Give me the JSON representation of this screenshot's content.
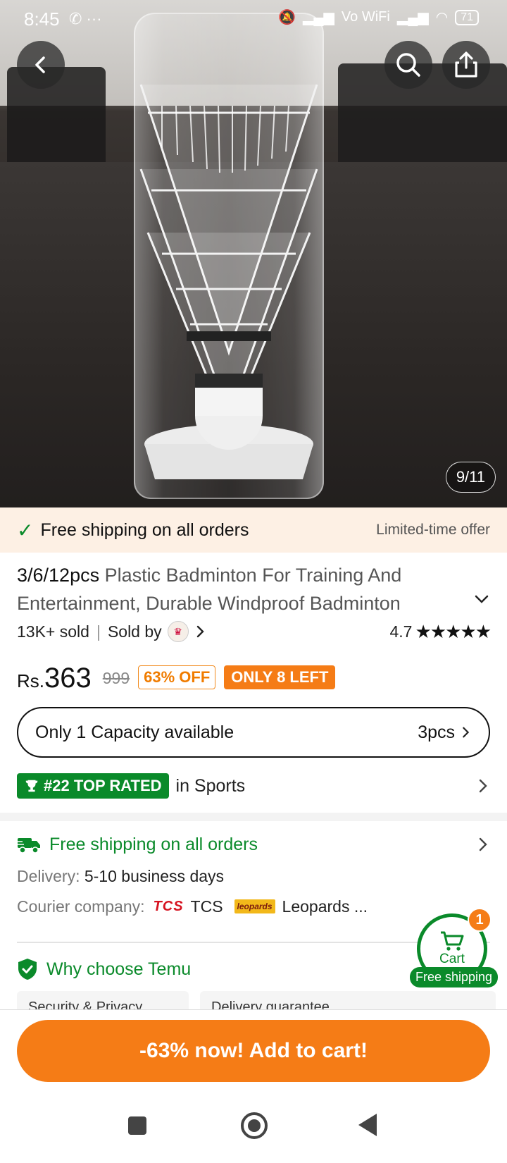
{
  "status_bar": {
    "time": "8:45",
    "left_icons": "✆ ···",
    "signal": "Vo WiFi",
    "battery": "71"
  },
  "gallery": {
    "counter": "9/11"
  },
  "icons": {
    "back": "chevron-left-icon",
    "search": "search-icon",
    "share": "share-icon"
  },
  "banner": {
    "title": "Free shipping on all orders",
    "offer": "Limited-time offer"
  },
  "product": {
    "title_qty": "3/6/12pcs",
    "title_rest": " Plastic Badminton For Training And Entertainment, Durable Windproof Badminton",
    "sold": "13K+ sold",
    "sold_by": "Sold by",
    "rating": "4.7",
    "stars": 4.7
  },
  "price": {
    "currency": "Rs.",
    "current": "363",
    "original": "999",
    "discount": "63% OFF",
    "stock": "ONLY 8 LEFT"
  },
  "capacity": {
    "label": "Only 1 Capacity available",
    "value": "3pcs"
  },
  "top_rated": {
    "badge": "#22 TOP RATED",
    "category": "in Sports"
  },
  "shipping": {
    "title": "Free shipping on all orders",
    "delivery_label": "Delivery:",
    "delivery_value": "5-10 business days",
    "courier_label": "Courier company:",
    "courier_1_logo": "TCS",
    "courier_1": "TCS",
    "courier_2_logo": "leopards",
    "courier_2": "Leopards ..."
  },
  "why": {
    "title": "Why choose Temu",
    "card_1": "Security & Privacy",
    "card_2": "Delivery guarantee"
  },
  "cart": {
    "count": "1",
    "label": "Cart",
    "free": "Free shipping"
  },
  "cta": {
    "label": "-63% now! Add to cart!"
  },
  "colors": {
    "accent_orange": "#f57c16",
    "accent_green": "#0a8a2a",
    "banner_bg": "#fdf0e4"
  }
}
